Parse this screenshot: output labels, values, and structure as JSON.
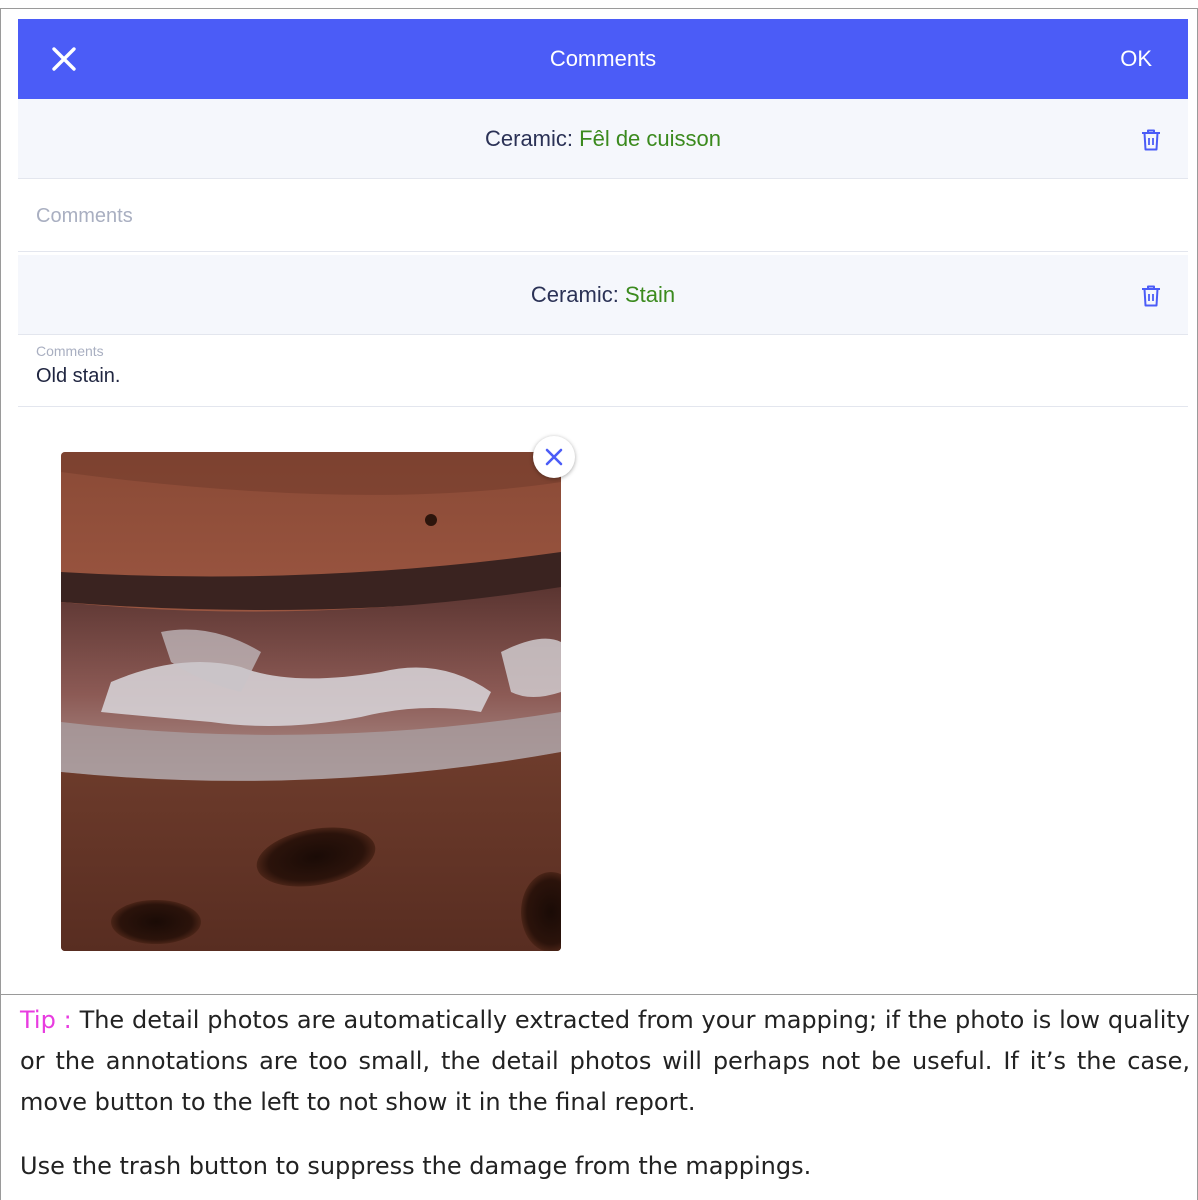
{
  "appbar": {
    "title": "Comments",
    "ok_label": "OK",
    "close_icon": "close-icon",
    "color": "#4b5cf7"
  },
  "damages": [
    {
      "category": "Ceramic:",
      "type": "Fêl de cuisson",
      "comment_placeholder": "Comments",
      "comment_value": ""
    },
    {
      "category": "Ceramic:",
      "type": "Stain",
      "comment_label": "Comments",
      "comment_value": "Old stain."
    }
  ],
  "colors": {
    "damage_type": "#3b8a1e",
    "tip_label": "#e83ce0"
  },
  "tip": {
    "label": "Tip :",
    "text": "The detail photos are automatically extracted from your mapping; if the photo is low quality or the annotations are too small, the detail photos will perhaps not be useful. If it’s the case, move button to the left to not show it in the final report.",
    "text2": "Use the trash button to suppress the damage from the mappings."
  }
}
